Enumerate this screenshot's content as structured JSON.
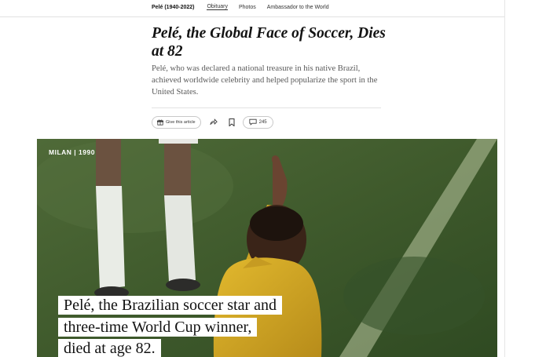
{
  "nav": {
    "series": "Pelé (1940-2022)",
    "links": [
      "Obituary",
      "Photos",
      "Ambassador to the World"
    ],
    "active_index": 0
  },
  "article": {
    "headline": "Pelé, the Global Face of Soccer, Dies at 82",
    "summary": "Pelé, who was declared a national treasure in his native Brazil, achieved worldwide celebrity and helped popularize the sport in the United States."
  },
  "share": {
    "gift_label": "Give this article",
    "comment_count": "245",
    "icons": [
      "gift-icon",
      "share-icon",
      "bookmark-icon",
      "comment-icon"
    ]
  },
  "video": {
    "location_tag": "MILAN | 1990",
    "caption": "Pelé, the Brazilian soccer star and three-time World Cup winner, died at age 82."
  }
}
